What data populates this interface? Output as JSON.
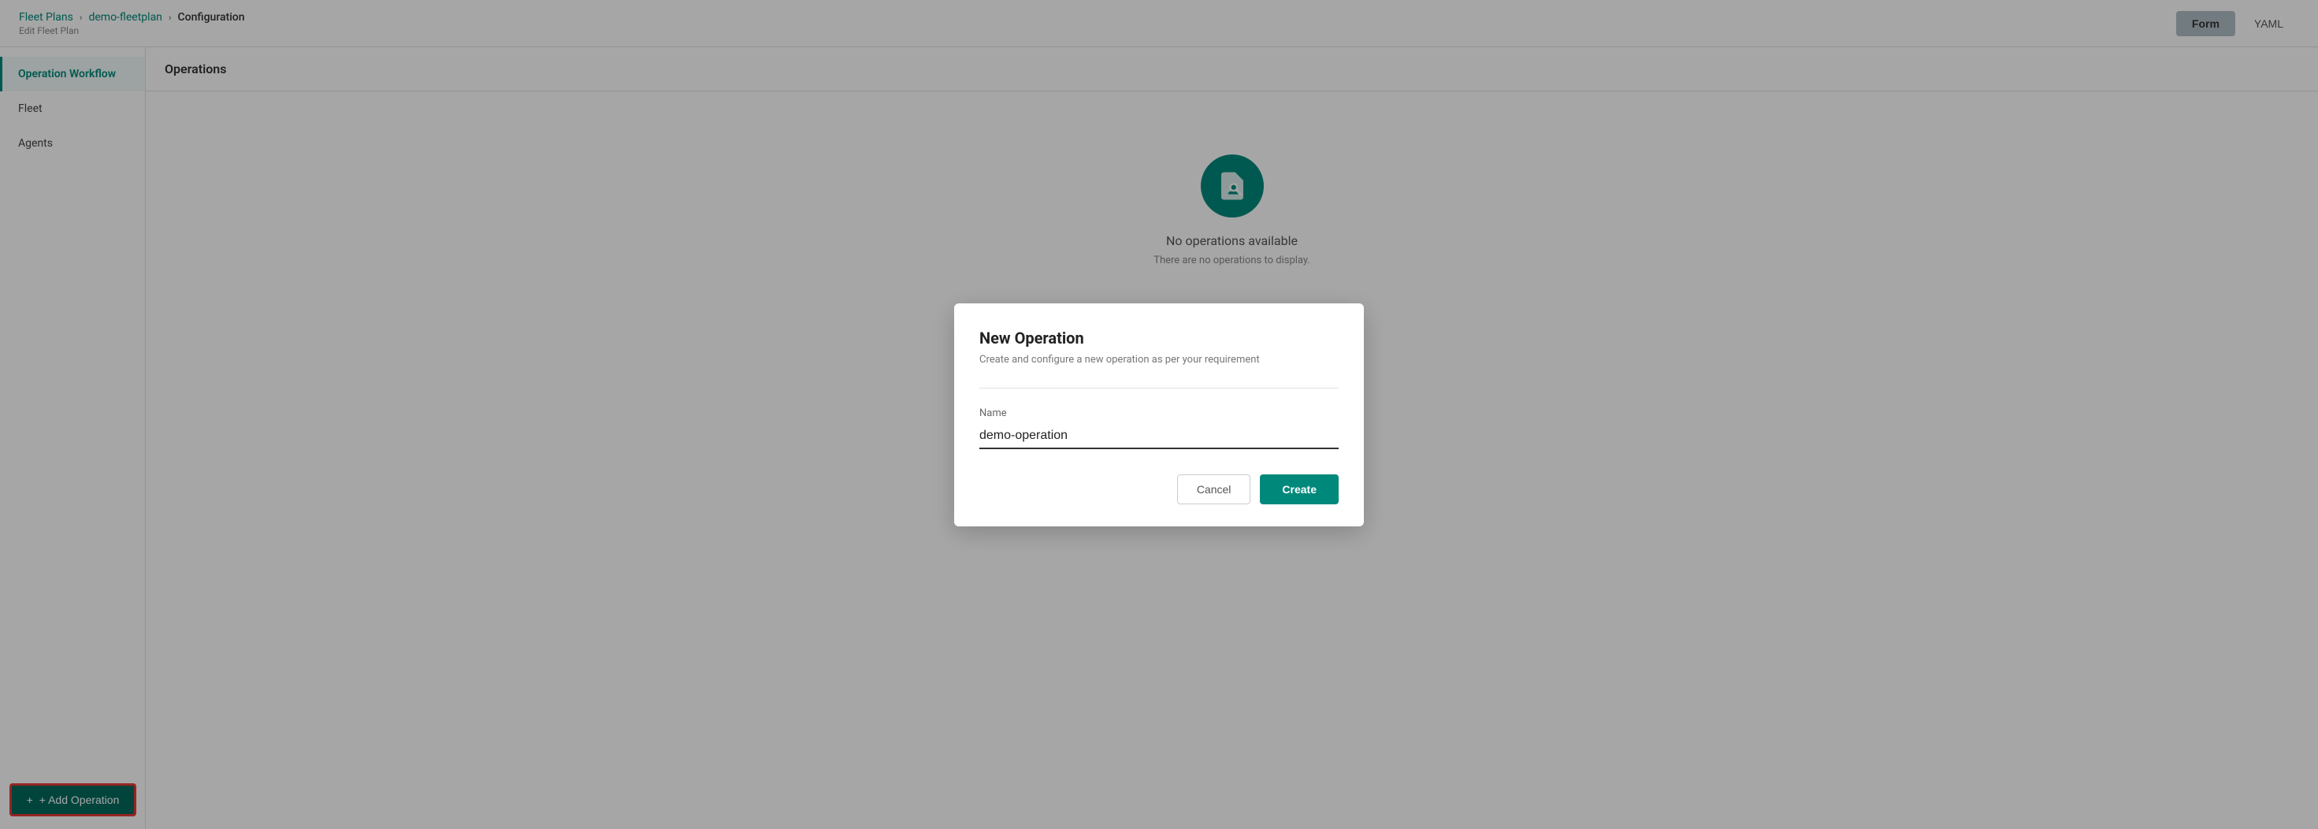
{
  "header": {
    "breadcrumb": {
      "fleet_plans": "Fleet Plans",
      "separator1": "›",
      "demo_fleetplan": "demo-fleetplan",
      "separator2": "›",
      "configuration": "Configuration",
      "sub_label": "Edit Fleet Plan"
    },
    "form_button": "Form",
    "yaml_button": "YAML"
  },
  "sidebar": {
    "items": [
      {
        "id": "operation-workflow",
        "label": "Operation Workflow",
        "active": true
      },
      {
        "id": "fleet",
        "label": "Fleet",
        "active": false
      },
      {
        "id": "agents",
        "label": "Agents",
        "active": false
      }
    ],
    "add_operation_label": "+ Add Operation"
  },
  "main": {
    "section_title": "Operations",
    "empty_state": {
      "icon": "search-document",
      "title": "No operations available",
      "description": "There are no operations to display."
    }
  },
  "modal": {
    "title": "New Operation",
    "subtitle": "Create and configure a new operation as per your requirement",
    "name_label": "Name",
    "name_value": "demo-operation",
    "name_placeholder": "",
    "cancel_label": "Cancel",
    "create_label": "Create"
  }
}
